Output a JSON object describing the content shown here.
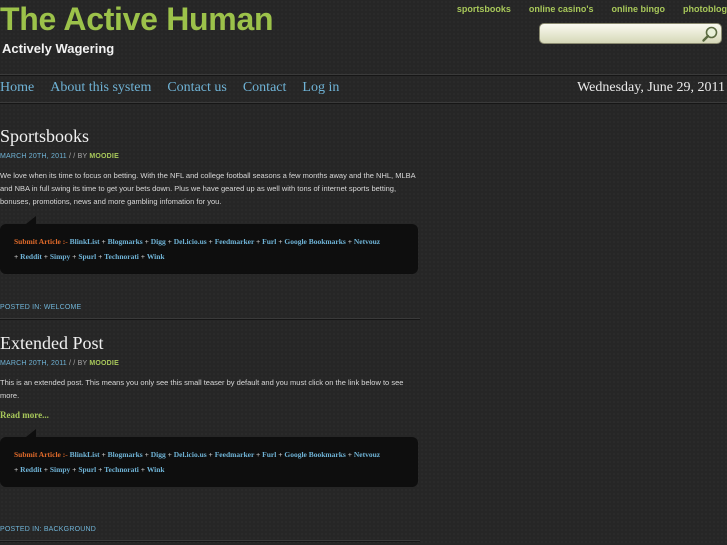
{
  "header": {
    "site_title": "The Active Human",
    "tagline": "Actively Wagering",
    "top_links": [
      "sportsbooks",
      "online casino's",
      "online bingo",
      "photoblog"
    ],
    "search_placeholder": ""
  },
  "nav": {
    "items": [
      "Home",
      "About this system",
      "Contact us",
      "Contact",
      "Log in"
    ],
    "date": "Wednesday, June 29, 2011"
  },
  "posts": [
    {
      "title": "Sportsbooks",
      "date": "MARCH 20TH, 2011",
      "by": " / / BY ",
      "author": "MOODIE",
      "body": "We love when its time to focus on betting. With the NFL and college football seasons a few months away and the NHL, MLBA and NBA in full swing its time to get your  bets down. Plus we have geared up as well with tons of internet sports betting, bonuses, promotions, news and more gambling infomation for you.",
      "read_more": "",
      "posted_in": "POSTED IN: WELCOME"
    },
    {
      "title": "Extended Post",
      "date": "MARCH 20TH, 2011",
      "by": " / / BY ",
      "author": "MOODIE",
      "body": "This is an extended post. This means you only see this small teaser by default and you must click on the link below to see more.",
      "read_more": "Read more...",
      "posted_in": "POSTED IN: BACKGROUND"
    }
  ],
  "submit": {
    "label": "Submit Article :-",
    "links": [
      "BlinkList",
      "Blogmarks",
      "Digg",
      "Del.icio.us",
      "Feedmarker",
      "Furl",
      "Google Bookmarks",
      "Netvouz",
      "Reddit",
      "Simpy",
      "Spurl",
      "Technorati",
      "Wink"
    ],
    "sep": "+"
  },
  "colors": {
    "title_green": "#9cc24a",
    "link_blue": "#6fb3d6",
    "submit_orange": "#e06a2a",
    "background": "#262626"
  }
}
